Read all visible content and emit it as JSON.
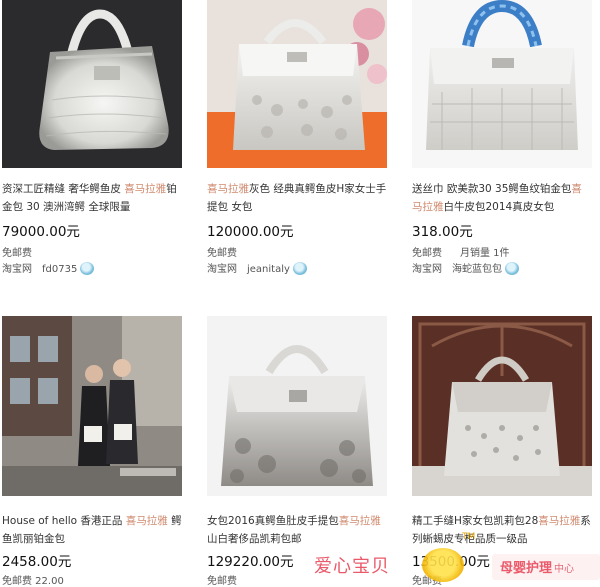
{
  "listings": [
    {
      "title_pre": "资深工匠精缝 奢华鳄鱼皮 ",
      "title_hl": "喜马拉雅",
      "title_post": "铂金包 30 澳洲湾鳄 全球限量",
      "price": "79000.00元",
      "shipping": "免邮费",
      "sold": "",
      "platform": "淘宝网",
      "seller": "fd0735",
      "image": "white crocodile handbag on dark background"
    },
    {
      "title_pre": "",
      "title_hl": "喜马拉雅",
      "title_post": "灰色 经典真鳄鱼皮H家女士手提包 女包",
      "price": "120000.00元",
      "shipping": "免邮费",
      "sold": "",
      "platform": "淘宝网",
      "seller": "jeanitaly",
      "image": "white crocodile handbag on orange box"
    },
    {
      "title_pre": "送丝巾 欧美款30 35鳄鱼纹铂金包",
      "title_hl": "喜马拉雅",
      "title_post": "白牛皮包2014真皮女包",
      "price": "318.00元",
      "shipping": "免邮费",
      "sold": "月销量 1件",
      "platform": "淘宝网",
      "seller": "海蛇蓝包包",
      "image": "white handbag with blue wrapped handle"
    },
    {
      "title_pre": "House of hello 香港正品 ",
      "title_hl": "喜马拉雅",
      "title_post": " 鳄鱼凯丽铂金包",
      "price": "2458.00元",
      "shipping": "免邮费 22.00",
      "sold": "",
      "platform": "",
      "seller": "",
      "image": "two women holding bags in street"
    },
    {
      "title_pre": "女包2016真鳄鱼肚皮手提包",
      "title_hl": "喜马拉雅",
      "title_post": "山白奢侈品凯莉包邮",
      "price": "129220.00元",
      "shipping": "免邮费",
      "sold": "",
      "platform": "",
      "seller": "",
      "image": "grey crocodile kelly bag"
    },
    {
      "title_pre": "精工手缝H家女包凯莉包28",
      "title_hl": "喜马拉雅",
      "title_post": "系列蜥蜴皮专柜品质一级品",
      "price": "13500.00元",
      "shipping": "免邮费",
      "sold": "",
      "platform": "",
      "seller": "",
      "image": "lizard kelly bag on carved wood"
    }
  ],
  "watermark": {
    "left": "爱心宝贝",
    "tm": "TM",
    "right": "母婴护理",
    "right_small": "中心"
  },
  "colors": {
    "highlight": "#d08a6e",
    "watermark": "#ea5a6a"
  }
}
